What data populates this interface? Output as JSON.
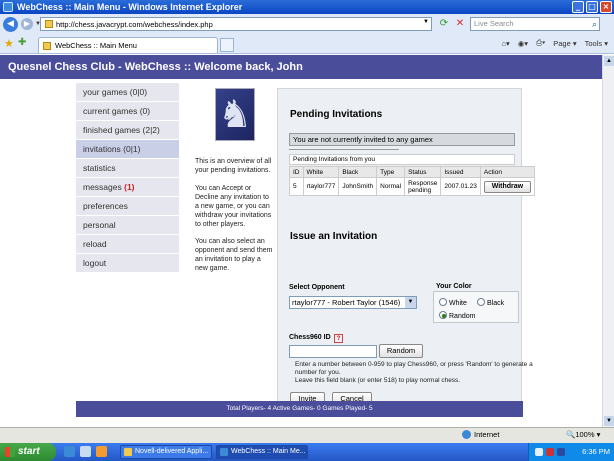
{
  "window": {
    "title": "WebChess :: Main Menu - Windows Internet Explorer",
    "minimize": "_",
    "maximize": "□",
    "close": "×"
  },
  "address_bar": {
    "url": "http://chess.javacrypt.com/webchess/index.php",
    "search_placeholder": "Live Search"
  },
  "tab": {
    "title": "WebChess :: Main Menu"
  },
  "toolbar": {
    "page_label": "Page",
    "tools_label": "Tools"
  },
  "site": {
    "header": "Quesnel Chess Club - WebChess :: Welcome back, John"
  },
  "menu": {
    "items": [
      {
        "label": "your games (0|0)"
      },
      {
        "label": "current games (0)"
      },
      {
        "label": "finished games (2|2)"
      },
      {
        "label": "invitations (0|1)"
      },
      {
        "label": "statistics"
      },
      {
        "label": "messages",
        "badge": "(1)"
      },
      {
        "label": "preferences"
      },
      {
        "label": "personal"
      },
      {
        "label": "reload"
      },
      {
        "label": "logout"
      }
    ]
  },
  "help": {
    "p1": "This is an overview of all your pending invitations.",
    "p2": "You can Accept or Decline any invitation to a new game, or you can withdraw your invitations to other players.",
    "p3": "You can also select an opponent and send them an invitation to play a new game."
  },
  "pending": {
    "title": "Pending Invitations",
    "not_invited": "You are not currently invited to any gamex",
    "from_you_caption": "Pending Invitations from you",
    "columns": [
      "ID",
      "White",
      "Black",
      "Type",
      "Status",
      "Issued",
      "Action"
    ],
    "rows": [
      {
        "id": "5",
        "white": "rtaylor777",
        "black": "JohnSmith",
        "type": "Normal",
        "status": "Response pending",
        "issued": "2007.01.23",
        "action": "Withdraw"
      }
    ]
  },
  "issue": {
    "title": "Issue an Invitation",
    "select_opponent_label": "Select Opponent",
    "selected_opponent": "rtaylor777 - Robert Taylor (1546)",
    "your_color_label": "Your Color",
    "color_white": "White",
    "color_black": "Black",
    "color_random": "Random",
    "chess960_label": "Chess960 ID",
    "help_mark": "?",
    "random_button": "Random",
    "hint1": "Enter a number between 0-959 to play Chess960, or press 'Random' to generate a number for you.",
    "hint2": "Leave this field blank (or enter 518) to play normal chess.",
    "invite_button": "Invite",
    "cancel_button": "Cancel"
  },
  "footer": {
    "text": "Total Players- 4     Active Games- 0     Games Played- 5"
  },
  "statusbar": {
    "zone": "Internet",
    "zoom": "100%"
  },
  "taskbar": {
    "start": "start",
    "items": [
      {
        "label": "Novell-delivered Appli..."
      },
      {
        "label": "WebChess :: Main Me..."
      }
    ],
    "clock": "6:36 PM"
  }
}
